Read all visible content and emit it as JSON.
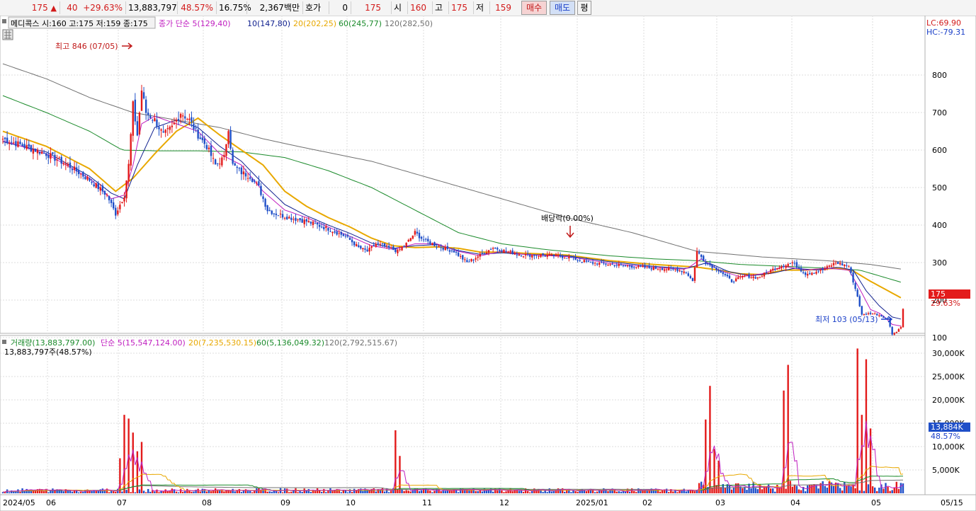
{
  "quote": {
    "price": "175",
    "change": "40",
    "change_pct": "+29.63%",
    "volume": "13,883,797",
    "vol_ratio": "48.57%",
    "turnover": "16.75%",
    "amount": "2,367백만",
    "hoga_label": "호가",
    "hoga_value": "0",
    "hoga_price": "175",
    "open_label": "시",
    "open": "160",
    "high_label": "고",
    "high": "175",
    "low_label": "저",
    "low": "159",
    "buy_button": "매수",
    "sell_button": "매도",
    "eval_button": "평"
  },
  "price_panel": {
    "title": "메디콕스 시:160 고:175 저:159 종:175",
    "ma_labels": [
      "종가 단순 5(129,40)",
      "10(147,80)",
      "20(202,25)",
      "60(245,77)",
      "120(282,50)"
    ],
    "ma_colors": [
      "#c020c0",
      "#10208f",
      "#e8a800",
      "#1a8a2a",
      "#707070"
    ],
    "lc": "LC:69.90",
    "hc": "HC:-79.31",
    "last_price_tag": "175",
    "last_pct": "29.63%",
    "high_annotation": "최고 846 (07/05)",
    "low_annotation": "최저 103 (05/13)",
    "dividend_annotation": "배당락(0.00%)"
  },
  "volume_panel": {
    "title": "거래량(13,883,797.00)",
    "ma_labels": [
      "단순 5(15,547,124.00)",
      "20(7,235,530.15)",
      "60(5,136,049.32)",
      "120(2,792,515.67)"
    ],
    "ma_colors": [
      "#c020c0",
      "#e8a800",
      "#1a8a2a",
      "#707070"
    ],
    "subtitle": "13,883,797주(48.57%)",
    "last_volume_tag": "13,884K",
    "last_volume_pct": "48.57%"
  },
  "chart_data": {
    "type": "candlestick",
    "price_axis_ticks": [
      100,
      200,
      300,
      400,
      500,
      600,
      700,
      800
    ],
    "price_range": [
      70,
      880
    ],
    "volume_axis_ticks": [
      "5,000K",
      "10,000K",
      "15,000K",
      "20,000K",
      "25,000K",
      "30,000K"
    ],
    "volume_axis_values": [
      5000,
      10000,
      15000,
      20000,
      25000,
      30000
    ],
    "volume_range_k": [
      0,
      33000
    ],
    "x_ticks": [
      "2024/05",
      "06",
      "07",
      "08",
      "09",
      "10",
      "11",
      "12",
      "2025/01",
      "02",
      "03",
      "04",
      "05",
      "05/15"
    ],
    "colors": {
      "up": "#e31b1b",
      "down": "#1f4fc8",
      "ma5": "#c020c0",
      "ma10": "#10208f",
      "ma20": "#e8a800",
      "ma60": "#1a8a2a",
      "ma120": "#707070"
    },
    "close_path": [
      [
        0,
        630
      ],
      [
        10,
        610
      ],
      [
        20,
        590
      ],
      [
        30,
        560
      ],
      [
        40,
        520
      ],
      [
        48,
        480
      ],
      [
        52,
        430
      ],
      [
        56,
        480
      ],
      [
        58,
        560
      ],
      [
        60,
        720
      ],
      [
        62,
        640
      ],
      [
        64,
        760
      ],
      [
        66,
        700
      ],
      [
        70,
        680
      ],
      [
        74,
        640
      ],
      [
        78,
        660
      ],
      [
        82,
        700
      ],
      [
        86,
        680
      ],
      [
        90,
        640
      ],
      [
        94,
        610
      ],
      [
        98,
        560
      ],
      [
        102,
        580
      ],
      [
        104,
        660
      ],
      [
        106,
        560
      ],
      [
        110,
        540
      ],
      [
        114,
        530
      ],
      [
        118,
        500
      ],
      [
        122,
        440
      ],
      [
        126,
        430
      ],
      [
        132,
        420
      ],
      [
        140,
        410
      ],
      [
        150,
        390
      ],
      [
        158,
        370
      ],
      [
        164,
        340
      ],
      [
        168,
        330
      ],
      [
        172,
        350
      ],
      [
        178,
        340
      ],
      [
        182,
        330
      ],
      [
        186,
        350
      ],
      [
        190,
        380
      ],
      [
        194,
        360
      ],
      [
        200,
        345
      ],
      [
        208,
        330
      ],
      [
        214,
        300
      ],
      [
        220,
        320
      ],
      [
        226,
        340
      ],
      [
        232,
        330
      ],
      [
        240,
        320
      ],
      [
        250,
        320
      ],
      [
        260,
        315
      ],
      [
        270,
        300
      ],
      [
        280,
        295
      ],
      [
        290,
        290
      ],
      [
        300,
        285
      ],
      [
        310,
        282
      ],
      [
        315,
        275
      ],
      [
        318,
        250
      ],
      [
        320,
        330
      ],
      [
        324,
        300
      ],
      [
        330,
        280
      ],
      [
        336,
        250
      ],
      [
        342,
        265
      ],
      [
        348,
        260
      ],
      [
        356,
        285
      ],
      [
        364,
        300
      ],
      [
        370,
        270
      ],
      [
        378,
        280
      ],
      [
        384,
        300
      ],
      [
        390,
        290
      ],
      [
        392,
        250
      ],
      [
        394,
        210
      ],
      [
        396,
        160
      ],
      [
        400,
        165
      ],
      [
        404,
        160
      ],
      [
        408,
        150
      ],
      [
        410,
        110
      ],
      [
        412,
        115
      ],
      [
        414,
        130
      ],
      [
        415,
        175
      ]
    ],
    "ma5_path": [
      [
        0,
        625
      ],
      [
        20,
        590
      ],
      [
        40,
        525
      ],
      [
        50,
        470
      ],
      [
        56,
        480
      ],
      [
        60,
        560
      ],
      [
        64,
        670
      ],
      [
        70,
        690
      ],
      [
        80,
        670
      ],
      [
        90,
        650
      ],
      [
        100,
        590
      ],
      [
        110,
        560
      ],
      [
        120,
        490
      ],
      [
        130,
        440
      ],
      [
        140,
        420
      ],
      [
        150,
        395
      ],
      [
        160,
        370
      ],
      [
        170,
        345
      ],
      [
        180,
        335
      ],
      [
        190,
        350
      ],
      [
        200,
        350
      ],
      [
        210,
        330
      ],
      [
        220,
        318
      ],
      [
        230,
        330
      ],
      [
        240,
        322
      ],
      [
        260,
        316
      ],
      [
        280,
        298
      ],
      [
        300,
        287
      ],
      [
        315,
        282
      ],
      [
        322,
        310
      ],
      [
        330,
        280
      ],
      [
        340,
        262
      ],
      [
        350,
        270
      ],
      [
        360,
        290
      ],
      [
        370,
        280
      ],
      [
        380,
        285
      ],
      [
        390,
        280
      ],
      [
        395,
        230
      ],
      [
        400,
        175
      ],
      [
        405,
        163
      ],
      [
        410,
        135
      ],
      [
        415,
        130
      ]
    ],
    "ma10_path": [
      [
        0,
        622
      ],
      [
        20,
        595
      ],
      [
        40,
        530
      ],
      [
        50,
        485
      ],
      [
        56,
        470
      ],
      [
        62,
        560
      ],
      [
        70,
        660
      ],
      [
        80,
        680
      ],
      [
        90,
        660
      ],
      [
        100,
        610
      ],
      [
        110,
        570
      ],
      [
        120,
        510
      ],
      [
        130,
        455
      ],
      [
        140,
        425
      ],
      [
        150,
        400
      ],
      [
        160,
        378
      ],
      [
        170,
        352
      ],
      [
        180,
        338
      ],
      [
        190,
        345
      ],
      [
        200,
        348
      ],
      [
        210,
        332
      ],
      [
        220,
        322
      ],
      [
        230,
        326
      ],
      [
        240,
        322
      ],
      [
        260,
        318
      ],
      [
        280,
        302
      ],
      [
        300,
        290
      ],
      [
        315,
        284
      ],
      [
        325,
        300
      ],
      [
        335,
        275
      ],
      [
        345,
        265
      ],
      [
        355,
        272
      ],
      [
        365,
        285
      ],
      [
        375,
        280
      ],
      [
        385,
        288
      ],
      [
        392,
        280
      ],
      [
        398,
        225
      ],
      [
        404,
        185
      ],
      [
        410,
        155
      ],
      [
        415,
        148
      ]
    ],
    "ma20_path": [
      [
        0,
        650
      ],
      [
        20,
        610
      ],
      [
        40,
        550
      ],
      [
        52,
        490
      ],
      [
        60,
        525
      ],
      [
        70,
        590
      ],
      [
        80,
        650
      ],
      [
        90,
        685
      ],
      [
        100,
        640
      ],
      [
        110,
        600
      ],
      [
        120,
        560
      ],
      [
        130,
        490
      ],
      [
        140,
        450
      ],
      [
        150,
        420
      ],
      [
        160,
        395
      ],
      [
        170,
        365
      ],
      [
        180,
        345
      ],
      [
        190,
        340
      ],
      [
        200,
        342
      ],
      [
        210,
        338
      ],
      [
        220,
        328
      ],
      [
        230,
        328
      ],
      [
        240,
        325
      ],
      [
        260,
        320
      ],
      [
        280,
        305
      ],
      [
        300,
        295
      ],
      [
        320,
        288
      ],
      [
        330,
        280
      ],
      [
        340,
        270
      ],
      [
        350,
        268
      ],
      [
        360,
        280
      ],
      [
        370,
        280
      ],
      [
        385,
        285
      ],
      [
        392,
        278
      ],
      [
        400,
        250
      ],
      [
        408,
        225
      ],
      [
        415,
        203
      ]
    ],
    "ma60_path": [
      [
        0,
        745
      ],
      [
        20,
        700
      ],
      [
        40,
        650
      ],
      [
        55,
        600
      ],
      [
        70,
        598
      ],
      [
        90,
        598
      ],
      [
        110,
        595
      ],
      [
        130,
        580
      ],
      [
        150,
        545
      ],
      [
        170,
        500
      ],
      [
        190,
        440
      ],
      [
        210,
        380
      ],
      [
        230,
        350
      ],
      [
        250,
        335
      ],
      [
        280,
        318
      ],
      [
        300,
        310
      ],
      [
        320,
        305
      ],
      [
        340,
        295
      ],
      [
        360,
        290
      ],
      [
        380,
        285
      ],
      [
        395,
        280
      ],
      [
        415,
        246
      ]
    ],
    "ma120_path": [
      [
        0,
        830
      ],
      [
        20,
        790
      ],
      [
        40,
        740
      ],
      [
        60,
        700
      ],
      [
        80,
        680
      ],
      [
        100,
        660
      ],
      [
        120,
        630
      ],
      [
        140,
        605
      ],
      [
        170,
        570
      ],
      [
        200,
        520
      ],
      [
        230,
        470
      ],
      [
        260,
        420
      ],
      [
        290,
        380
      ],
      [
        320,
        330
      ],
      [
        350,
        315
      ],
      [
        380,
        305
      ],
      [
        400,
        295
      ],
      [
        415,
        282
      ]
    ],
    "annotations": [
      {
        "text": "최고 846 (07/05)",
        "value": 846
      },
      {
        "text": "최저 103 (05/13)",
        "value": 103
      },
      {
        "text": "배당락(0.00%)"
      }
    ],
    "volume_spikes": [
      {
        "label": "07",
        "values_k": [
          7500,
          16800,
          16000,
          13000,
          9000,
          11000
        ]
      },
      {
        "label": "10",
        "values_k": [
          13500,
          8000
        ]
      },
      {
        "label": "03",
        "values_k": [
          15800,
          23000,
          9500,
          7000
        ]
      },
      {
        "label": "04",
        "values_k": [
          22000,
          27500
        ]
      },
      {
        "label": "05",
        "values_k": [
          31000,
          16800,
          28700,
          13884
        ]
      }
    ]
  }
}
